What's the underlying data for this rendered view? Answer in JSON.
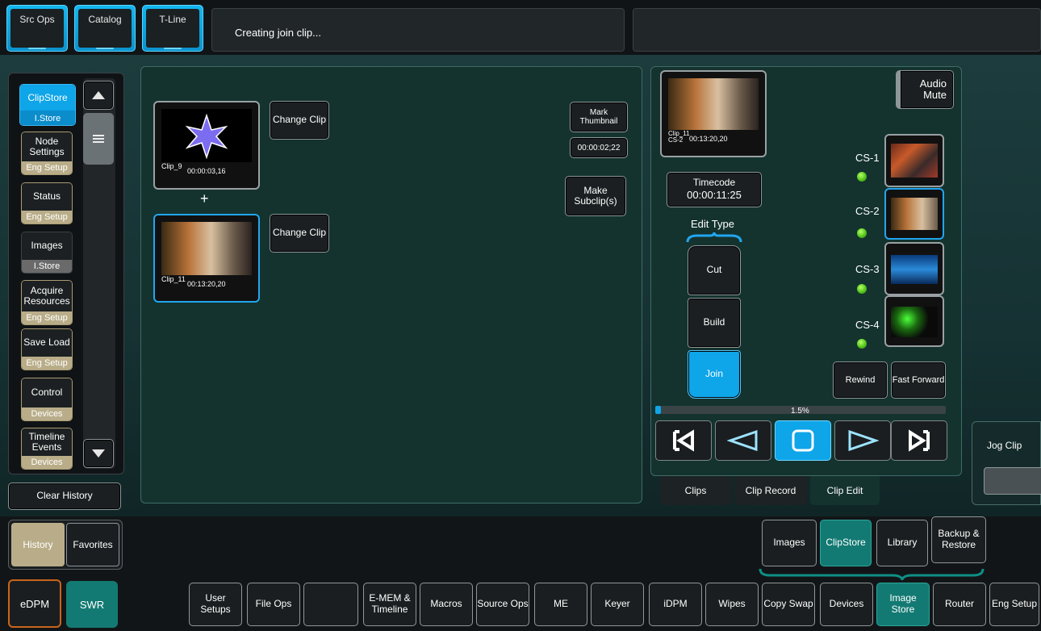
{
  "top_tabs": [
    {
      "label": "Src Ops"
    },
    {
      "label": "Catalog"
    },
    {
      "label": "T-Line"
    }
  ],
  "status_message": "Creating join clip...",
  "sidebar": {
    "items": [
      {
        "label": "ClipStore",
        "sub": "I.Store"
      },
      {
        "label": "Node Settings",
        "sub": "Eng Setup"
      },
      {
        "label": "Status",
        "sub": "Eng Setup"
      },
      {
        "label": "Images",
        "sub": "I.Store"
      },
      {
        "label": "Acquire Resources",
        "sub": "Eng Setup"
      },
      {
        "label": "Save Load",
        "sub": "Eng Setup"
      },
      {
        "label": "Control",
        "sub": "Devices"
      },
      {
        "label": "Timeline Events",
        "sub": "Devices"
      }
    ],
    "clear_history": "Clear History",
    "history": "History",
    "favorites": "Favorites"
  },
  "clip_list": {
    "clip1": {
      "name": "Clip_9",
      "timecode": "00:00:03,16"
    },
    "plus": "+",
    "clip2": {
      "name": "Clip_11",
      "timecode": "00:13:20,20"
    },
    "change_clip": "Change Clip",
    "mark_thumbnail": "Mark Thumbnail",
    "mark_timecode": "00:00:02;22",
    "make_subclips": "Make Subclip(s)"
  },
  "clip_edit": {
    "preview": {
      "name": "Clip_11",
      "channel": "CS-2",
      "timecode": "00:13:20,20"
    },
    "audio_mute": "Audio Mute",
    "timecode_label": "Timecode",
    "timecode_value": "00:00:11:25",
    "edit_type_label": "Edit Type",
    "edit_types": [
      "Cut",
      "Build",
      "Join"
    ],
    "channels": [
      "CS-1",
      "CS-2",
      "CS-3",
      "CS-4"
    ],
    "rewind": "Rewind",
    "fast_forward": "Fast Forward",
    "progress_text": "1.5%",
    "progress": 0.015,
    "tabs": [
      "Clips",
      "Clip Record",
      "Clip Edit"
    ]
  },
  "jog_clip": "Jog Clip",
  "sub_menu": [
    "Images",
    "ClipStore",
    "Library",
    "Backup & Restore"
  ],
  "mode": {
    "edpm": "eDPM",
    "swr": "SWR"
  },
  "bottom_menu": [
    "User Setups",
    "File Ops",
    "",
    "E-MEM & Timeline",
    "Macros",
    "Source Ops",
    "ME",
    "Keyer",
    "iDPM",
    "Wipes",
    "Copy Swap",
    "Devices",
    "Image Store",
    "Router",
    "Eng Setup"
  ],
  "colors": {
    "accent": "#0ea5e9",
    "teal": "#137a73",
    "tan": "#b9ad89",
    "orange": "#c8651c"
  }
}
